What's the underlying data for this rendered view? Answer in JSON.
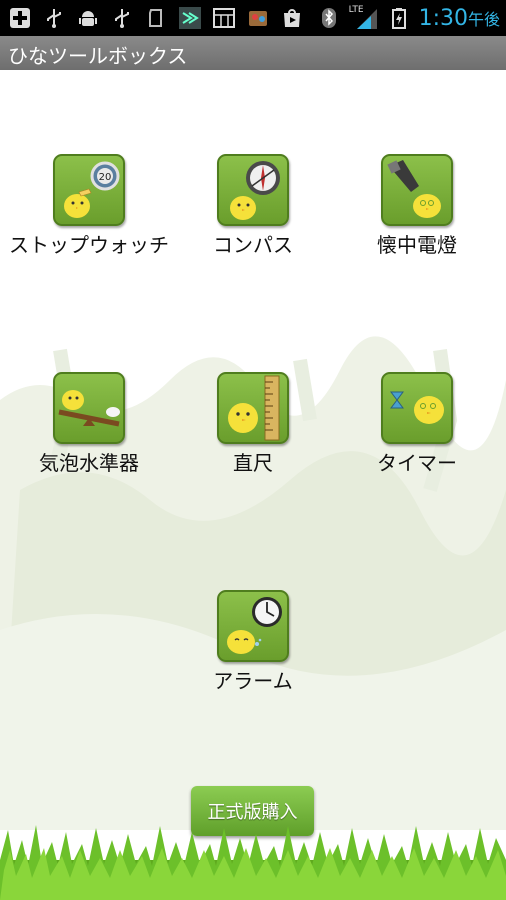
{
  "status_bar": {
    "time": "1:30",
    "ampm": "午後",
    "network": "LTE",
    "icons": [
      "plus-icon",
      "usb-icon",
      "android-icon",
      "usb-icon",
      "sd-icon",
      "arrow-app-icon",
      "grid-app-icon",
      "game-app-icon",
      "play-store-icon",
      "bluetooth-icon",
      "signal-icon",
      "battery-icon"
    ]
  },
  "app": {
    "title": "ひなツールボックス"
  },
  "tools": [
    {
      "id": "stopwatch",
      "label": "ストップウォッチ",
      "icon": "stopwatch-icon",
      "badge": "20"
    },
    {
      "id": "compass",
      "label": "コンパス",
      "icon": "compass-icon"
    },
    {
      "id": "flashlight",
      "label": "懐中電燈",
      "icon": "flashlight-icon"
    },
    {
      "id": "level",
      "label": "気泡水準器",
      "icon": "bubble-level-icon"
    },
    {
      "id": "ruler",
      "label": "直尺",
      "icon": "ruler-icon"
    },
    {
      "id": "timer",
      "label": "タイマー",
      "icon": "timer-icon"
    },
    {
      "id": "alarm",
      "label": "アラーム",
      "icon": "alarm-clock-icon"
    }
  ],
  "buy_button": {
    "label": "正式版購入"
  },
  "colors": {
    "accent_green": "#6a9e2c",
    "status_blue": "#33b5e5",
    "titlebar_gray": "#7a7a7a"
  }
}
